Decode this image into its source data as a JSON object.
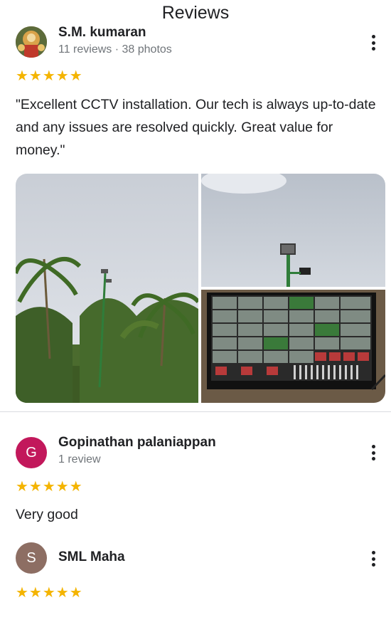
{
  "page": {
    "title": "Reviews"
  },
  "reviews": [
    {
      "name": "S.M. kumaran",
      "meta": "11 reviews · 38 photos",
      "stars": "★★★★★",
      "rating": 5,
      "text": "\"Excellent CCTV installation. Our tech is always up-to-date and any issues are resolved quickly. Great value for money.\"",
      "avatar": {
        "type": "photo"
      },
      "photos": [
        {
          "icon": "coconut-palms-with-cctv-pole-photo"
        },
        {
          "icon": "cctv-camera-on-pole-photo"
        },
        {
          "icon": "cctv-monitor-grid-photo"
        }
      ]
    },
    {
      "name": "Gopinathan palaniappan",
      "meta": "1 review",
      "stars": "★★★★★",
      "rating": 5,
      "text": "Very good",
      "avatar": {
        "type": "letter",
        "letter": "G",
        "color": "#c2185b"
      }
    },
    {
      "name": "SML Maha",
      "meta": "",
      "stars": "★★★★★",
      "rating": 5,
      "text": "",
      "avatar": {
        "type": "letter",
        "letter": "S",
        "color": "#8d6e63"
      }
    }
  ],
  "colors": {
    "star": "#f4b400",
    "divider": "#dadce0",
    "meta_text": "#70757a"
  }
}
